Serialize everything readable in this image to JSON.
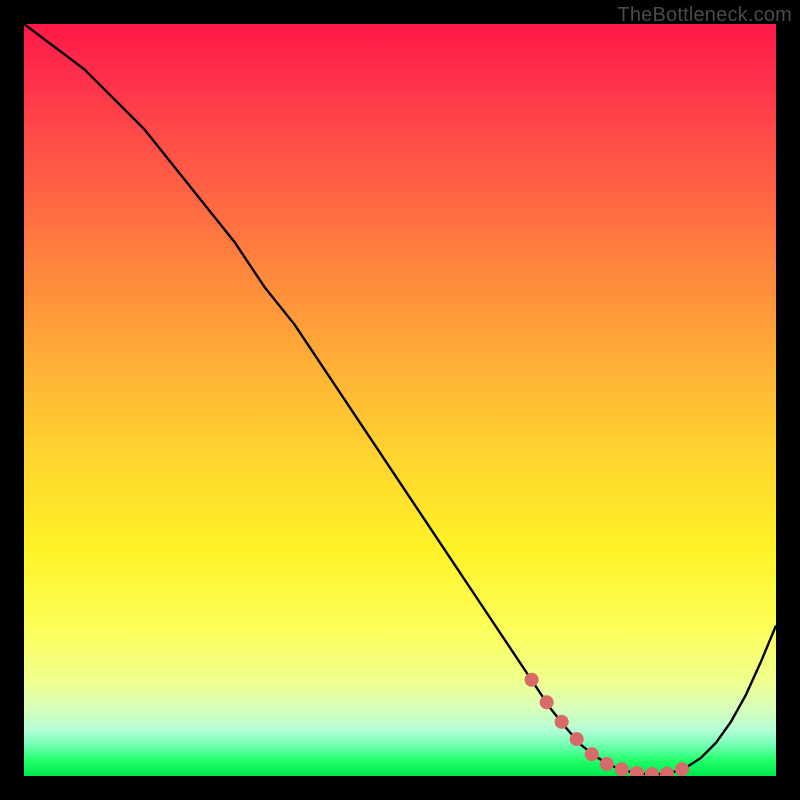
{
  "watermark": "TheBottleneck.com",
  "chart_data": {
    "type": "line",
    "title": "",
    "xlabel": "",
    "ylabel": "",
    "xlim": [
      0,
      100
    ],
    "ylim": [
      0,
      100
    ],
    "series": [
      {
        "name": "bottleneck-curve",
        "x": [
          0,
          4,
          8,
          12,
          16,
          20,
          24,
          28,
          32,
          36,
          40,
          44,
          48,
          52,
          56,
          60,
          64,
          68,
          70,
          72,
          74,
          76,
          78,
          80,
          82,
          84,
          86,
          88,
          90,
          92,
          94,
          96,
          98,
          100
        ],
        "y": [
          100,
          97,
          94,
          90,
          86,
          81,
          76,
          71,
          65,
          60,
          54,
          48,
          42,
          36,
          30,
          24,
          18,
          12,
          9,
          6.5,
          4.2,
          2.6,
          1.4,
          0.7,
          0.3,
          0.2,
          0.4,
          1.1,
          2.4,
          4.4,
          7.2,
          10.8,
          15.2,
          20
        ]
      }
    ],
    "highlight_points": {
      "name": "optimal-range-dots",
      "x": [
        67.5,
        69.5,
        71.5,
        73.5,
        75.5,
        77.5,
        79.5,
        81.5,
        83.5,
        85.5,
        87.5
      ],
      "y": [
        12.8,
        9.8,
        7.2,
        4.9,
        2.9,
        1.6,
        0.9,
        0.4,
        0.25,
        0.3,
        0.9
      ]
    },
    "gradient_colors": {
      "top": "#ff1848",
      "mid_high": "#ff8a3c",
      "mid": "#ffd62e",
      "mid_low": "#fdff57",
      "low": "#1eff68",
      "bottom": "#00e84b"
    }
  }
}
